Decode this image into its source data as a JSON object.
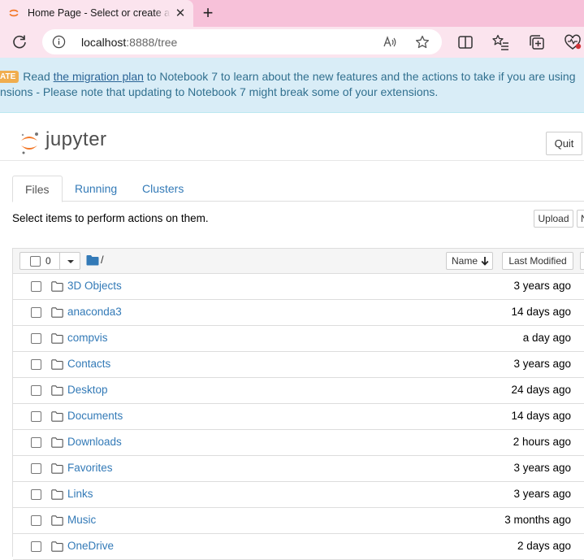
{
  "browser": {
    "tab_title": "Home Page - Select or create a notebook",
    "url_host": "localhost",
    "url_rest": ":8888/tree"
  },
  "notice": {
    "badge": "ATE",
    "line1_prefix": "Read ",
    "link_text": "the migration plan",
    "line1_suffix": " to Notebook 7 to learn about the new features and the actions to take if you are using",
    "line2": "nsions - Please note that updating to Notebook 7 might break some of your extensions."
  },
  "header": {
    "logo_text": "jupyter",
    "quit_label": "Quit"
  },
  "tabs": [
    {
      "label": "Files"
    },
    {
      "label": "Running"
    },
    {
      "label": "Clusters"
    }
  ],
  "files_view": {
    "instructions": "Select items to perform actions on them.",
    "upload_label": "Upload",
    "new_label": "N",
    "selected_count": "0",
    "breadcrumb_path": "/",
    "sort_name_label": "Name",
    "sort_modified_label": "Last Modified",
    "items": [
      {
        "name": "3D Objects",
        "modified": "3 years ago"
      },
      {
        "name": "anaconda3",
        "modified": "14 days ago"
      },
      {
        "name": "compvis",
        "modified": "a day ago"
      },
      {
        "name": "Contacts",
        "modified": "3 years ago"
      },
      {
        "name": "Desktop",
        "modified": "24 days ago"
      },
      {
        "name": "Documents",
        "modified": "14 days ago"
      },
      {
        "name": "Downloads",
        "modified": "2 hours ago"
      },
      {
        "name": "Favorites",
        "modified": "3 years ago"
      },
      {
        "name": "Links",
        "modified": "3 years ago"
      },
      {
        "name": "Music",
        "modified": "3 months ago"
      },
      {
        "name": "OneDrive",
        "modified": "2 days ago"
      }
    ]
  },
  "colors": {
    "tabstrip": "#f7c1d9",
    "link": "#337ab7",
    "notice_bg": "#d9edf7",
    "jupyter_orange": "#f37726"
  }
}
